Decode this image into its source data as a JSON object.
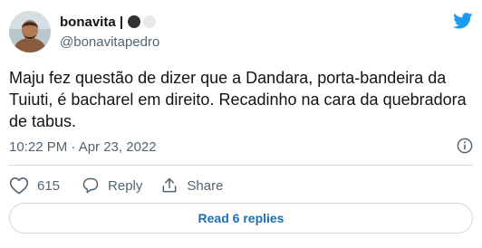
{
  "author": {
    "display_name": "bonavita |",
    "handle": "@bonavitapedro",
    "avatar_icon": "profile-photo",
    "name_badges": [
      "dark-circle",
      "light-circle"
    ]
  },
  "tweet": {
    "text": "Maju fez questão de dizer que a Dandara, porta-bandeira da Tuiuti, é bacharel em direito. Recadinho na cara da quebradora de tabus.",
    "timestamp": "10:22 PM · Apr 23, 2022"
  },
  "actions": {
    "like_count": "615",
    "reply_label": "Reply",
    "share_label": "Share"
  },
  "footer": {
    "read_replies_label": "Read 6 replies"
  },
  "icons": {
    "brand": "twitter-bird-icon",
    "info": "info-icon",
    "like": "heart-icon",
    "reply": "reply-bubble-icon",
    "share": "share-icon"
  },
  "colors": {
    "brand_blue": "#1d9bf0",
    "link_blue": "#1d6fb5",
    "text_primary": "#0f1419",
    "text_secondary": "#536471",
    "border": "#cfd9de"
  }
}
